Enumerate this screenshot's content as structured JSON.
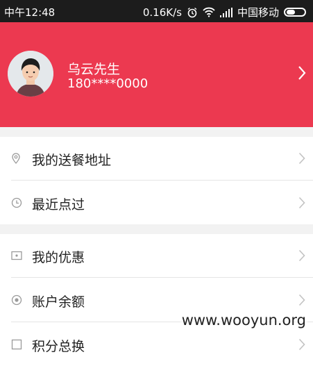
{
  "status_bar": {
    "time": "中午12:48",
    "speed": "0.16K/s",
    "carrier": "中国移动"
  },
  "profile": {
    "name": "乌云先生",
    "phone": "180****0000"
  },
  "menu": {
    "items": [
      {
        "label": "我的送餐地址",
        "icon": "location-pin-icon"
      },
      {
        "label": "最近点过",
        "icon": "clock-icon"
      },
      {
        "label": "我的优惠",
        "icon": "coupon-icon"
      },
      {
        "label": "账户余额",
        "icon": "balance-icon"
      },
      {
        "label": "积分总换",
        "icon": "points-icon"
      }
    ]
  },
  "watermark": "www.wooyun.org"
}
